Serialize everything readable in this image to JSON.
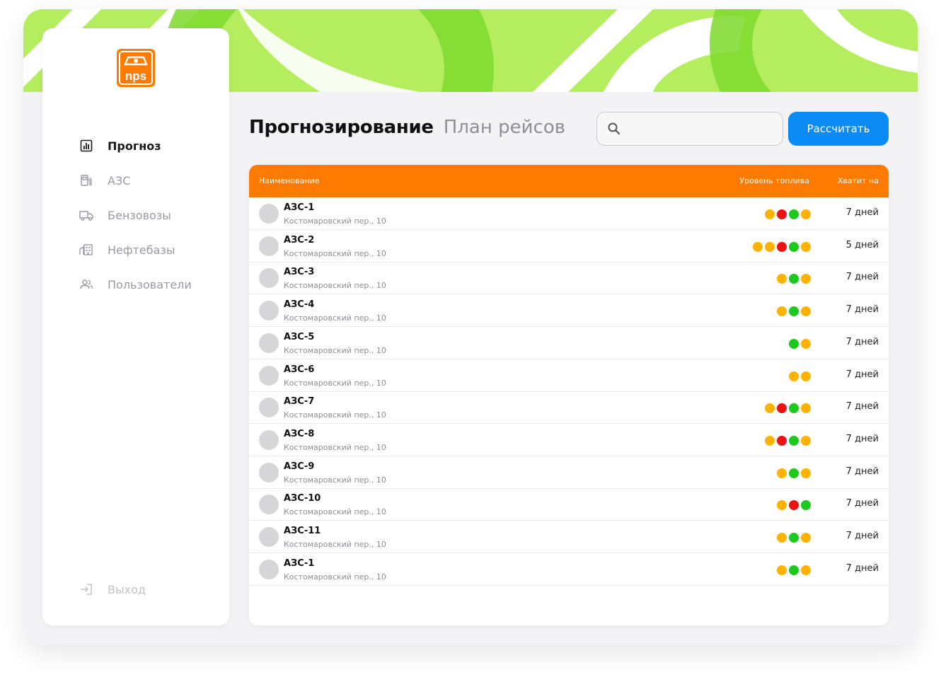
{
  "brand": {
    "logo_text": "nps",
    "accent": "#ff7a00",
    "banner_color": "#b4ee5e"
  },
  "sidebar": {
    "items": [
      {
        "label": "Прогноз",
        "icon": "chart-icon",
        "active": true
      },
      {
        "label": "АЗС",
        "icon": "fuel-station-icon",
        "active": false
      },
      {
        "label": "Бензовозы",
        "icon": "truck-icon",
        "active": false
      },
      {
        "label": "Нефтебазы",
        "icon": "building-icon",
        "active": false
      },
      {
        "label": "Пользователи",
        "icon": "users-icon",
        "active": false
      }
    ],
    "logout": {
      "label": "Выход",
      "icon": "logout-icon"
    }
  },
  "header": {
    "title": "Прогнозирование",
    "subtitle": "План рейсов",
    "search": {
      "value": "",
      "placeholder": ""
    },
    "calc_button": "Рассчитать",
    "calc_button_color": "#0a8bf5"
  },
  "table": {
    "columns": {
      "name": "Наименование",
      "level": "Уровень топлива",
      "days": "Хватит на"
    },
    "status_colors": {
      "yellow": "#ffb300",
      "red": "#ee1111",
      "green": "#1ec91e"
    },
    "rows": [
      {
        "name": "АЗС-1",
        "address": "Костомаровский пер., 10",
        "levels": [
          "yellow",
          "red",
          "green",
          "yellow"
        ],
        "days": "7 дней"
      },
      {
        "name": "АЗС-2",
        "address": "Костомаровский пер., 10",
        "levels": [
          "yellow",
          "yellow",
          "red",
          "green",
          "yellow"
        ],
        "days": "5 дней"
      },
      {
        "name": "АЗС-3",
        "address": "Костомаровский пер., 10",
        "levels": [
          "yellow",
          "green",
          "yellow"
        ],
        "days": "7 дней"
      },
      {
        "name": "АЗС-4",
        "address": "Костомаровский пер., 10",
        "levels": [
          "yellow",
          "green",
          "yellow"
        ],
        "days": "7 дней"
      },
      {
        "name": "АЗС-5",
        "address": "Костомаровский пер., 10",
        "levels": [
          "green",
          "yellow"
        ],
        "days": "7 дней"
      },
      {
        "name": "АЗС-6",
        "address": "Костомаровский пер., 10",
        "levels": [
          "yellow",
          "yellow"
        ],
        "days": "7 дней"
      },
      {
        "name": "АЗС-7",
        "address": "Костомаровский пер., 10",
        "levels": [
          "yellow",
          "red",
          "green",
          "yellow"
        ],
        "days": "7 дней"
      },
      {
        "name": "АЗС-8",
        "address": "Костомаровский пер., 10",
        "levels": [
          "yellow",
          "red",
          "green",
          "yellow"
        ],
        "days": "7 дней"
      },
      {
        "name": "АЗС-9",
        "address": "Костомаровский пер., 10",
        "levels": [
          "yellow",
          "green",
          "yellow"
        ],
        "days": "7 дней"
      },
      {
        "name": "АЗС-10",
        "address": "Костомаровский пер., 10",
        "levels": [
          "yellow",
          "red",
          "green"
        ],
        "days": "7 дней"
      },
      {
        "name": "АЗС-11",
        "address": "Костомаровский пер., 10",
        "levels": [
          "yellow",
          "green",
          "yellow"
        ],
        "days": "7 дней"
      },
      {
        "name": "АЗС-1",
        "address": "Костомаровский пер., 10",
        "levels": [
          "yellow",
          "green",
          "yellow"
        ],
        "days": "7 дней"
      }
    ]
  }
}
